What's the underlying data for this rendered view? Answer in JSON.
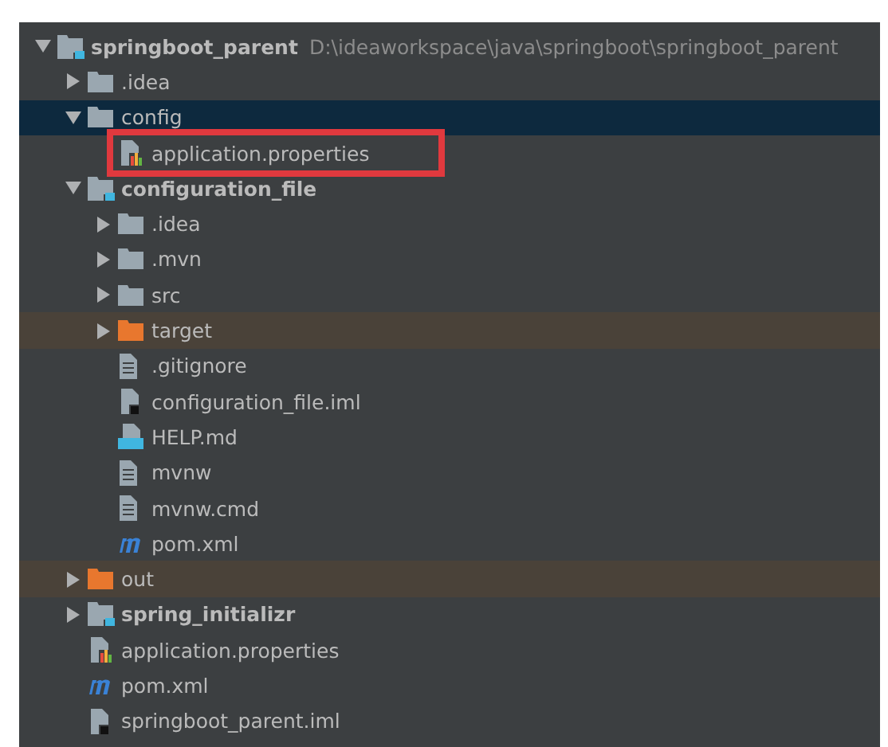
{
  "project_tree": [
    {
      "name": "springboot_parent",
      "kind": "module",
      "path": "D:\\ideaworkspace\\java\\springboot\\springboot_parent",
      "expanded": true,
      "selected": false,
      "children": [
        {
          "name": ".idea",
          "kind": "folder",
          "expanded": false,
          "selected": false
        },
        {
          "name": "config",
          "kind": "folder",
          "expanded": true,
          "selected": true,
          "children": [
            {
              "name": "application.properties",
              "kind": "properties",
              "selected": false,
              "highlighted": true
            }
          ]
        },
        {
          "name": "configuration_file",
          "kind": "module",
          "expanded": true,
          "selected": false,
          "children": [
            {
              "name": ".idea",
              "kind": "folder",
              "expanded": false,
              "selected": false
            },
            {
              "name": ".mvn",
              "kind": "folder",
              "expanded": false,
              "selected": false
            },
            {
              "name": "src",
              "kind": "folder",
              "expanded": false,
              "selected": false
            },
            {
              "name": "target",
              "kind": "excluded",
              "expanded": false,
              "selected": false
            },
            {
              "name": ".gitignore",
              "kind": "text",
              "selected": false
            },
            {
              "name": "configuration_file.iml",
              "kind": "iml",
              "selected": false
            },
            {
              "name": "HELP.md",
              "kind": "markdown",
              "selected": false
            },
            {
              "name": "mvnw",
              "kind": "text",
              "selected": false
            },
            {
              "name": "mvnw.cmd",
              "kind": "text",
              "selected": false
            },
            {
              "name": "pom.xml",
              "kind": "maven",
              "selected": false
            }
          ]
        },
        {
          "name": "out",
          "kind": "excluded",
          "expanded": false,
          "selected": false
        },
        {
          "name": "spring_initializr",
          "kind": "module",
          "expanded": false,
          "selected": false
        },
        {
          "name": "application.properties",
          "kind": "properties",
          "selected": false
        },
        {
          "name": "pom.xml",
          "kind": "maven",
          "selected": false
        },
        {
          "name": "springboot_parent.iml",
          "kind": "iml",
          "selected": false
        }
      ]
    }
  ]
}
